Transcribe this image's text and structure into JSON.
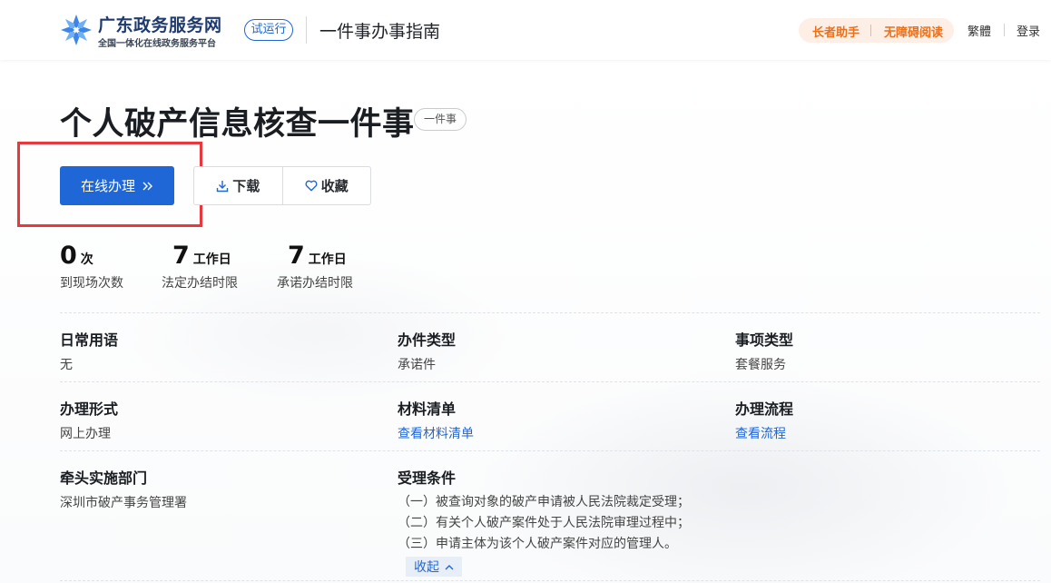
{
  "header": {
    "site_name": "广东政务服务网",
    "site_subtitle": "全国一体化在线政务服务平台",
    "trial_badge": "试运行",
    "guide_title": "一件事办事指南",
    "elder_assist": "长者助手",
    "accessible_read": "无障碍阅读",
    "traditional": "繁體",
    "login": "登录"
  },
  "main": {
    "title": "个人破产信息核查一件事",
    "title_tag": "一件事",
    "online_button": "在线办理",
    "download_button": "下载",
    "favorite_button": "收藏",
    "stats": [
      {
        "value": "0",
        "unit": "次",
        "label": "到现场次数"
      },
      {
        "value": "7",
        "unit": "工作日",
        "label": "法定办结时限"
      },
      {
        "value": "7",
        "unit": "工作日",
        "label": "承诺办结时限"
      }
    ],
    "info": {
      "common_terms": {
        "label": "日常用语",
        "value": "无"
      },
      "item_type": {
        "label": "办件类型",
        "value": "承诺件"
      },
      "matter_type": {
        "label": "事项类型",
        "value": "套餐服务"
      },
      "handle_form": {
        "label": "办理形式",
        "value": "网上办理"
      },
      "materials": {
        "label": "材料清单",
        "value": "查看材料清单"
      },
      "process": {
        "label": "办理流程",
        "value": "查看流程"
      },
      "department": {
        "label": "牵头实施部门",
        "value": "深圳市破产事务管理署"
      },
      "conditions": {
        "label": "受理条件",
        "items": [
          "（一）被查询对象的破产申请被人民法院裁定受理；",
          "（二）有关个人破产案件处于人民法院审理过程中；",
          "（三）申请主体为该个人破产案件对应的管理人。"
        ],
        "collapse": "收起"
      }
    }
  },
  "colors": {
    "primary": "#1f66d6",
    "accent_orange": "#e8711d",
    "highlight_red": "#e8383d"
  }
}
